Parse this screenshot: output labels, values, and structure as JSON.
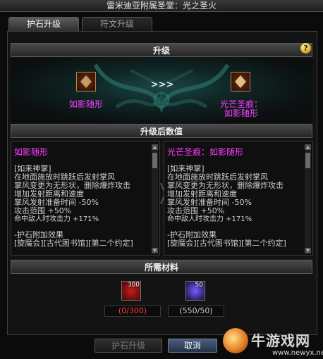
{
  "window": {
    "title": "雷米迪亚附属圣堂：光之圣火"
  },
  "tabs": [
    {
      "label": "护石升级",
      "active": true
    },
    {
      "label": "符文升级",
      "active": false
    }
  ],
  "upgrade": {
    "header": "升级",
    "help_label": "?",
    "arrow_glyph": ">>>",
    "from_item": {
      "name": "如影随形",
      "icon": "talisman-icon"
    },
    "to_item": {
      "name_line1": "光芒圣痕：",
      "name_line2": "如影随形",
      "icon": "talisman-icon"
    }
  },
  "after_values": {
    "header": "升级后数值",
    "left": {
      "title": "如影随形",
      "lines": [
        "[如来神掌]",
        "在地面施放时跳跃后发射掌风",
        "掌风变更为无形状，删除爆炸攻击",
        "增加发射距离和速度",
        "掌风发射准备时间 -50%",
        "攻击范围 +50%",
        "命中敌人时攻击力 +171%",
        "",
        "-护石附加效果",
        "[旋魔会][古代图书馆][第二个约定]"
      ]
    },
    "right": {
      "title": "光芒圣痕：如影随形",
      "lines": [
        "[如来神掌]",
        "在地面施放时跳跃后发射掌风",
        "掌风变更为无形状，删除爆炸攻击",
        "增加发射距离和速度",
        "掌风发射准备时间 -50%",
        "攻击范围 +50%",
        "命中敌人时攻击力 +171%",
        "",
        "-护石附加效果",
        "[旋魔会][古代图书馆][第二个约定]"
      ]
    }
  },
  "materials": {
    "header": "所需材料",
    "items": [
      {
        "icon": "crystal-red-icon",
        "count_badge": "300",
        "amount": "(0/300)",
        "color": "#ff3b3b"
      },
      {
        "icon": "crystal-blue-icon",
        "count_badge": "50",
        "amount": "(550/50)",
        "color": "#cfcfcf"
      }
    ]
  },
  "buttons": {
    "upgrade": "护石升级",
    "cancel": "取消"
  },
  "watermark": {
    "text": "牛游戏网",
    "url": "www.newyx.net"
  },
  "colors": {
    "accent_magenta": "#ff3cff",
    "insufficient_red": "#ff3b3b"
  }
}
